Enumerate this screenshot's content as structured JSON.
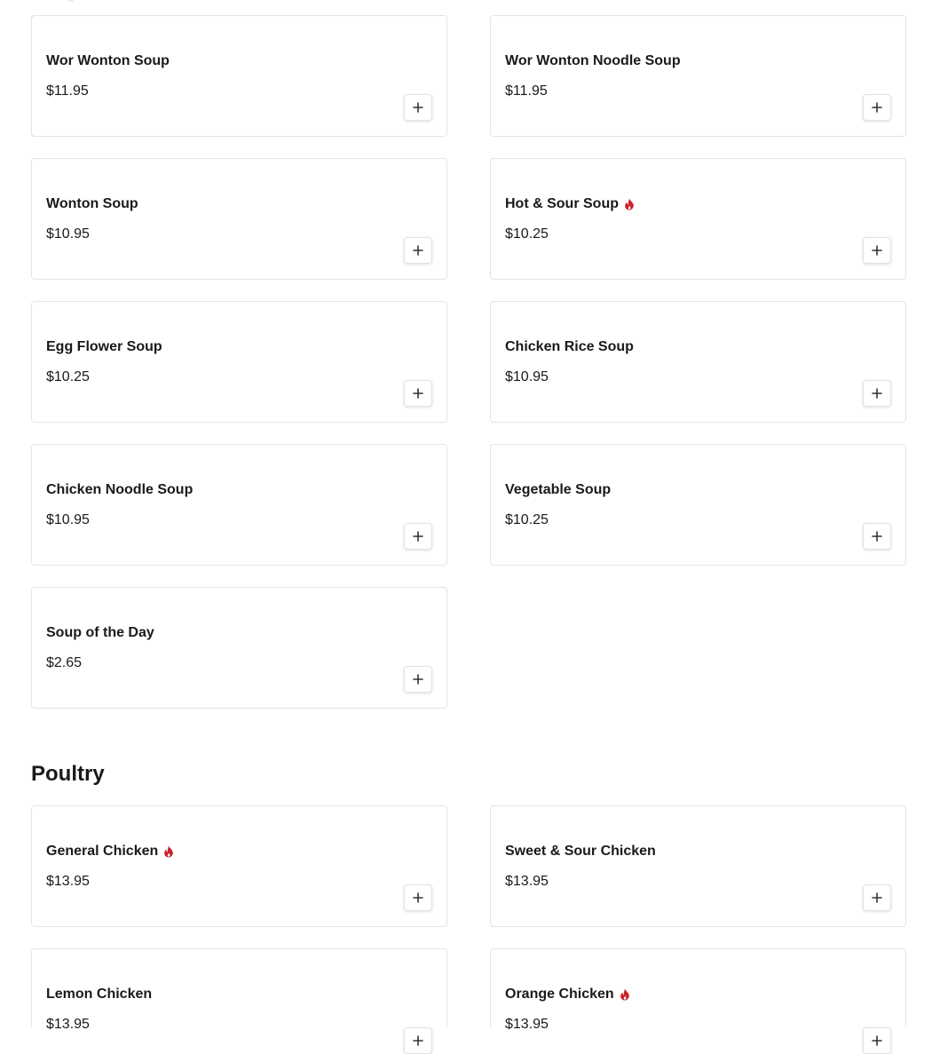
{
  "sections": [
    {
      "title": "",
      "items": [
        {
          "name": "Wor Wonton Soup",
          "price": "$11.95",
          "spicy": false
        },
        {
          "name": "Wor Wonton Noodle Soup",
          "price": "$11.95",
          "spicy": false
        },
        {
          "name": "Wonton Soup",
          "price": "$10.95",
          "spicy": false
        },
        {
          "name": "Hot & Sour Soup",
          "price": "$10.25",
          "spicy": true
        },
        {
          "name": "Egg Flower Soup",
          "price": "$10.25",
          "spicy": false
        },
        {
          "name": "Chicken Rice Soup",
          "price": "$10.95",
          "spicy": false
        },
        {
          "name": "Chicken Noodle Soup",
          "price": "$10.95",
          "spicy": false
        },
        {
          "name": "Vegetable Soup",
          "price": "$10.25",
          "spicy": false
        },
        {
          "name": "Soup of the Day",
          "price": "$2.65",
          "spicy": false
        }
      ]
    },
    {
      "title": "Poultry",
      "items": [
        {
          "name": "General Chicken",
          "price": "$13.95",
          "spicy": true
        },
        {
          "name": "Sweet & Sour Chicken",
          "price": "$13.95",
          "spicy": false
        },
        {
          "name": "Lemon Chicken",
          "price": "$13.95",
          "spicy": false
        },
        {
          "name": "Orange Chicken",
          "price": "$13.95",
          "spicy": true
        }
      ]
    }
  ],
  "icons": {
    "spicy": "flame-icon",
    "add": "plus-icon"
  },
  "colors": {
    "spicy": "#c8232c",
    "border": "#e4e4e4",
    "text": "#1a1a1a"
  }
}
